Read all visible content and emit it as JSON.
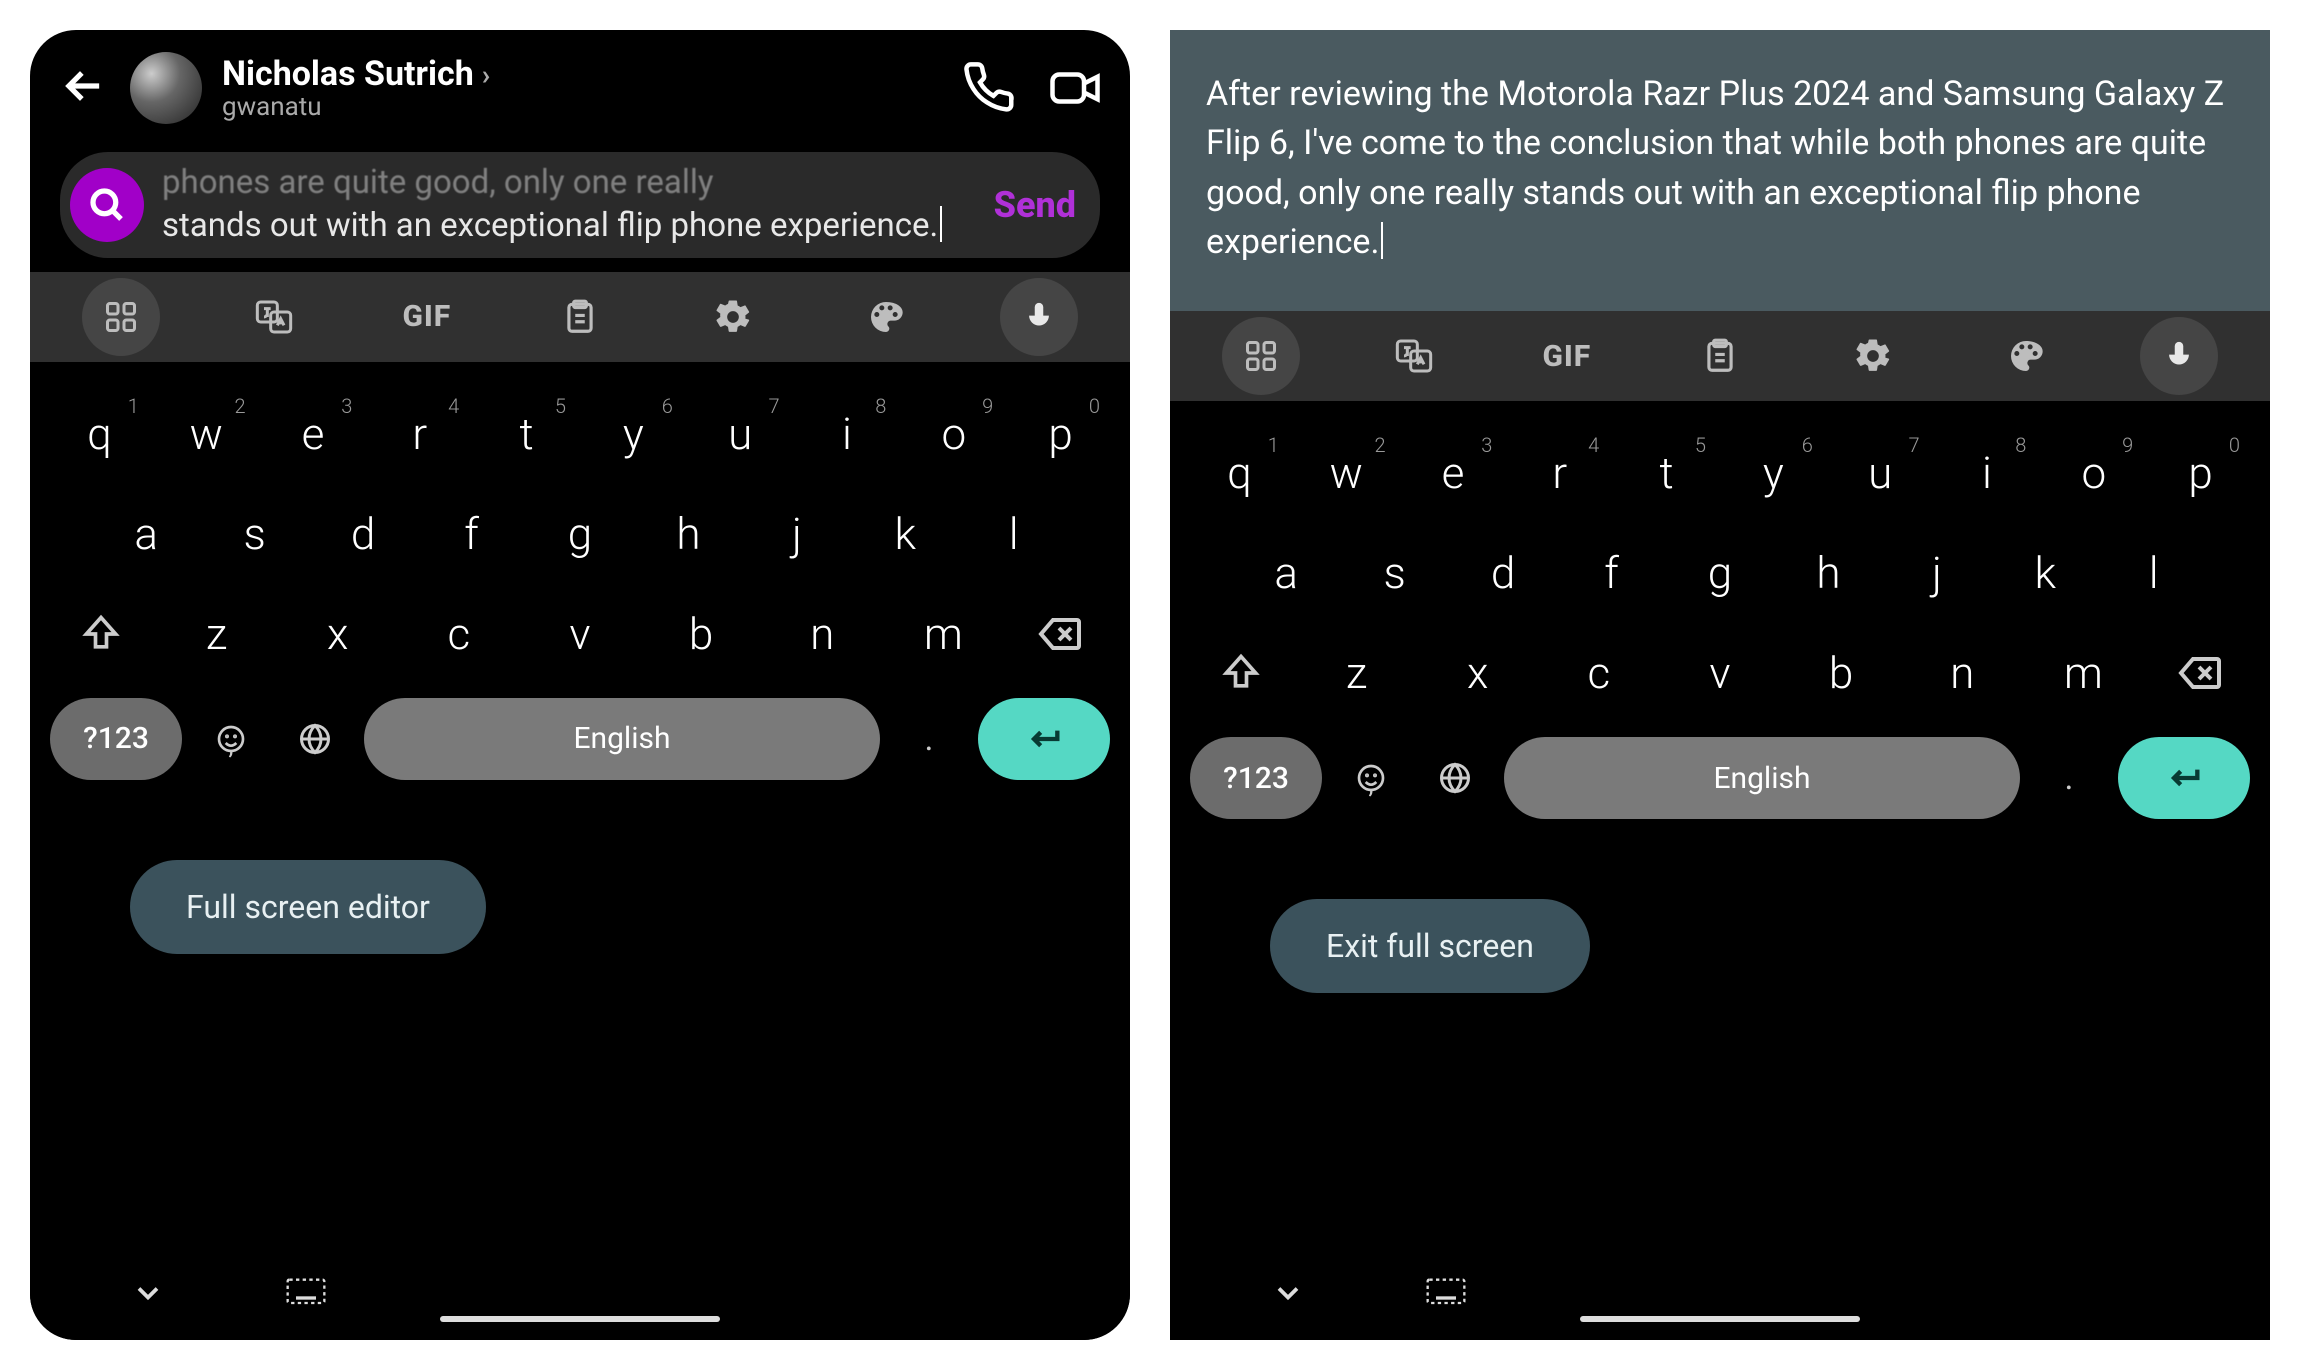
{
  "left": {
    "contact_name": "Nicholas Sutrich",
    "contact_handle": "gwanatu",
    "message_faded": "phones are quite good, only one really",
    "message_rest": "stands out with an exceptional flip phone experience.",
    "send_label": "Send",
    "fse_button": "Full screen editor"
  },
  "right": {
    "editor_text": "After reviewing the Motorola Razr Plus 2024 and Samsung Galaxy Z Flip 6, I've come to the conclusion that while both phones are quite good, only one really stands out with an exceptional flip phone experience.",
    "fse_button": "Exit full screen"
  },
  "toolbar": {
    "gif_label": "GIF"
  },
  "keyboard": {
    "row1": [
      {
        "k": "q",
        "n": "1"
      },
      {
        "k": "w",
        "n": "2"
      },
      {
        "k": "e",
        "n": "3"
      },
      {
        "k": "r",
        "n": "4"
      },
      {
        "k": "t",
        "n": "5"
      },
      {
        "k": "y",
        "n": "6"
      },
      {
        "k": "u",
        "n": "7"
      },
      {
        "k": "i",
        "n": "8"
      },
      {
        "k": "o",
        "n": "9"
      },
      {
        "k": "p",
        "n": "0"
      }
    ],
    "row2": [
      "a",
      "s",
      "d",
      "f",
      "g",
      "h",
      "j",
      "k",
      "l"
    ],
    "row3": [
      "z",
      "x",
      "c",
      "v",
      "b",
      "n",
      "m"
    ],
    "sym_label": "?123",
    "space_label": "English",
    "dot_label": "."
  }
}
